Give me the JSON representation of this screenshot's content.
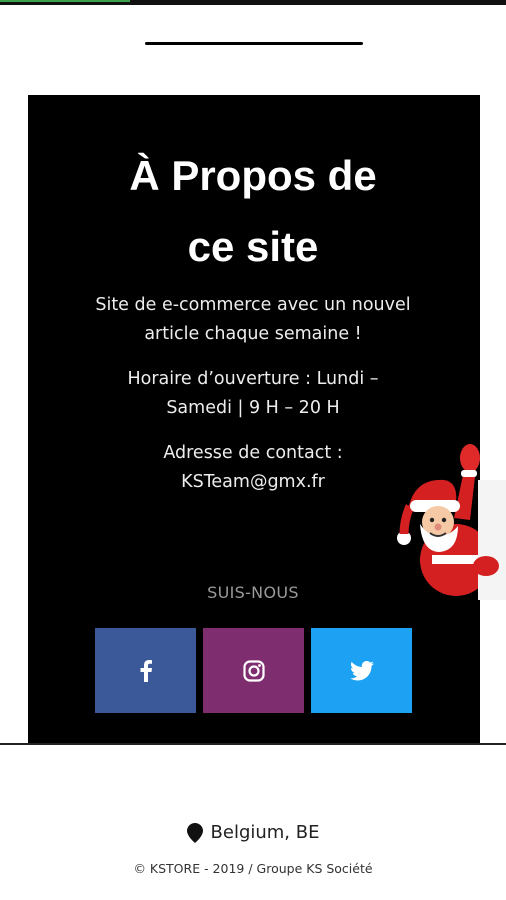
{
  "about": {
    "title_line1": "À Propos de",
    "title_line2": "ce site",
    "description": "Site de e-commerce avec un nouvel article chaque semaine !",
    "hours": "Horaire d’ouverture : Lundi – Samedi | 9 H – 20 H",
    "contact": "Adresse de contact : KSTeam@gmx.fr"
  },
  "social": {
    "label": "SUIS-NOUS",
    "buttons": [
      {
        "network": "facebook",
        "icon": "facebook-icon",
        "color": "#3b5998"
      },
      {
        "network": "instagram",
        "icon": "instagram-icon",
        "color": "#7e2d6e"
      },
      {
        "network": "twitter",
        "icon": "twitter-icon",
        "color": "#1da1f2"
      }
    ]
  },
  "footer": {
    "location": "Belgium, BE",
    "location_icon": "map-pin-icon",
    "copyright": "© KSTORE - 2019 / Groupe KS Société"
  },
  "decoration": {
    "image": "santa-claus-waving"
  },
  "colors": {
    "card_background": "#000000",
    "page_background": "#ffffff",
    "muted_label": "#9a9a9a"
  }
}
